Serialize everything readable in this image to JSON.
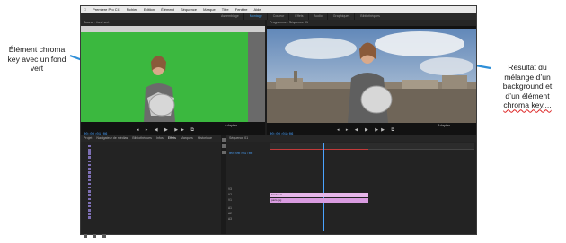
{
  "annotations": {
    "left_lines": [
      "Élément chroma",
      "key avec un fond",
      "vert"
    ],
    "right_lines": [
      "Résultat du",
      "mélange d’un",
      "background et",
      "d’un élément",
      "chroma key...."
    ]
  },
  "colors": {
    "arrow": "#2e8fd8",
    "green_screen": "#3bb83f",
    "timeline_clip": "#e7b6ea",
    "accent_blue": "#3d9ae8",
    "playhead": "#4aa3ff"
  },
  "app": {
    "menubar": [
      "Premiere Pro CC",
      "Fichier",
      "Edition",
      "Élément",
      "Séquence",
      "Marque",
      "Titre",
      "Fenêtre",
      "Aide"
    ],
    "workspace_tabs": [
      "Assemblage",
      "Montage",
      "Couleur",
      "Effets",
      "Audio",
      "Graphiques",
      "Bibliothèques"
    ],
    "source_panel": {
      "title": "Source : fond vert",
      "timecode": "00:00:01:06",
      "fit": "Adapter"
    },
    "program_panel": {
      "title": "Programme : Séquence 01",
      "timecode": "00:00:01:06",
      "fit": "Adapter"
    },
    "project_panel": {
      "tabs": [
        "Projet",
        "Navigateur de médias",
        "Bibliothèques",
        "Infos",
        "Effets",
        "Marques",
        "Historique"
      ]
    },
    "timeline_panel": {
      "tab": "Séquence 01",
      "timecode": "00:00:01:06",
      "tracks": [
        "V3",
        "V2",
        "V1",
        "A1",
        "A2",
        "A3"
      ],
      "clips": [
        {
          "track": "V2",
          "label": "fond vert"
        },
        {
          "track": "V1",
          "label": "paris.jpg"
        }
      ]
    }
  }
}
